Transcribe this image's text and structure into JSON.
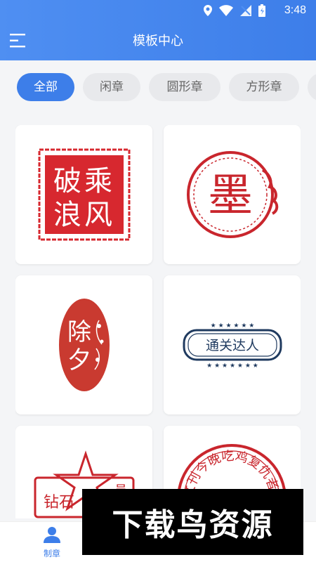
{
  "status": {
    "time": "3:48"
  },
  "header": {
    "title": "模板中心"
  },
  "tabs": [
    {
      "label": "全部",
      "active": true
    },
    {
      "label": "闲章",
      "active": false
    },
    {
      "label": "圆形章",
      "active": false
    },
    {
      "label": "方形章",
      "active": false
    }
  ],
  "seals": [
    {
      "chars": [
        "乘",
        "破",
        "风",
        "浪"
      ],
      "color": "#d7282f"
    },
    {
      "chars": [
        "墨"
      ],
      "color": "#c9262d"
    },
    {
      "chars": [
        "除",
        "夕"
      ],
      "color": "#c93a30"
    },
    {
      "chars": [
        "通关达人"
      ],
      "color": "#1f3a5f"
    },
    {
      "chars": [
        "钻石",
        "员"
      ],
      "color": "#c9262d"
    },
    {
      "chars": [
        "文刊今晚吃鸡复仇者"
      ],
      "color": "#c9262d"
    }
  ],
  "bottom_nav": [
    {
      "label": "制章",
      "icon": "user-icon"
    }
  ],
  "watermark": {
    "text": "下载鸟资源"
  }
}
